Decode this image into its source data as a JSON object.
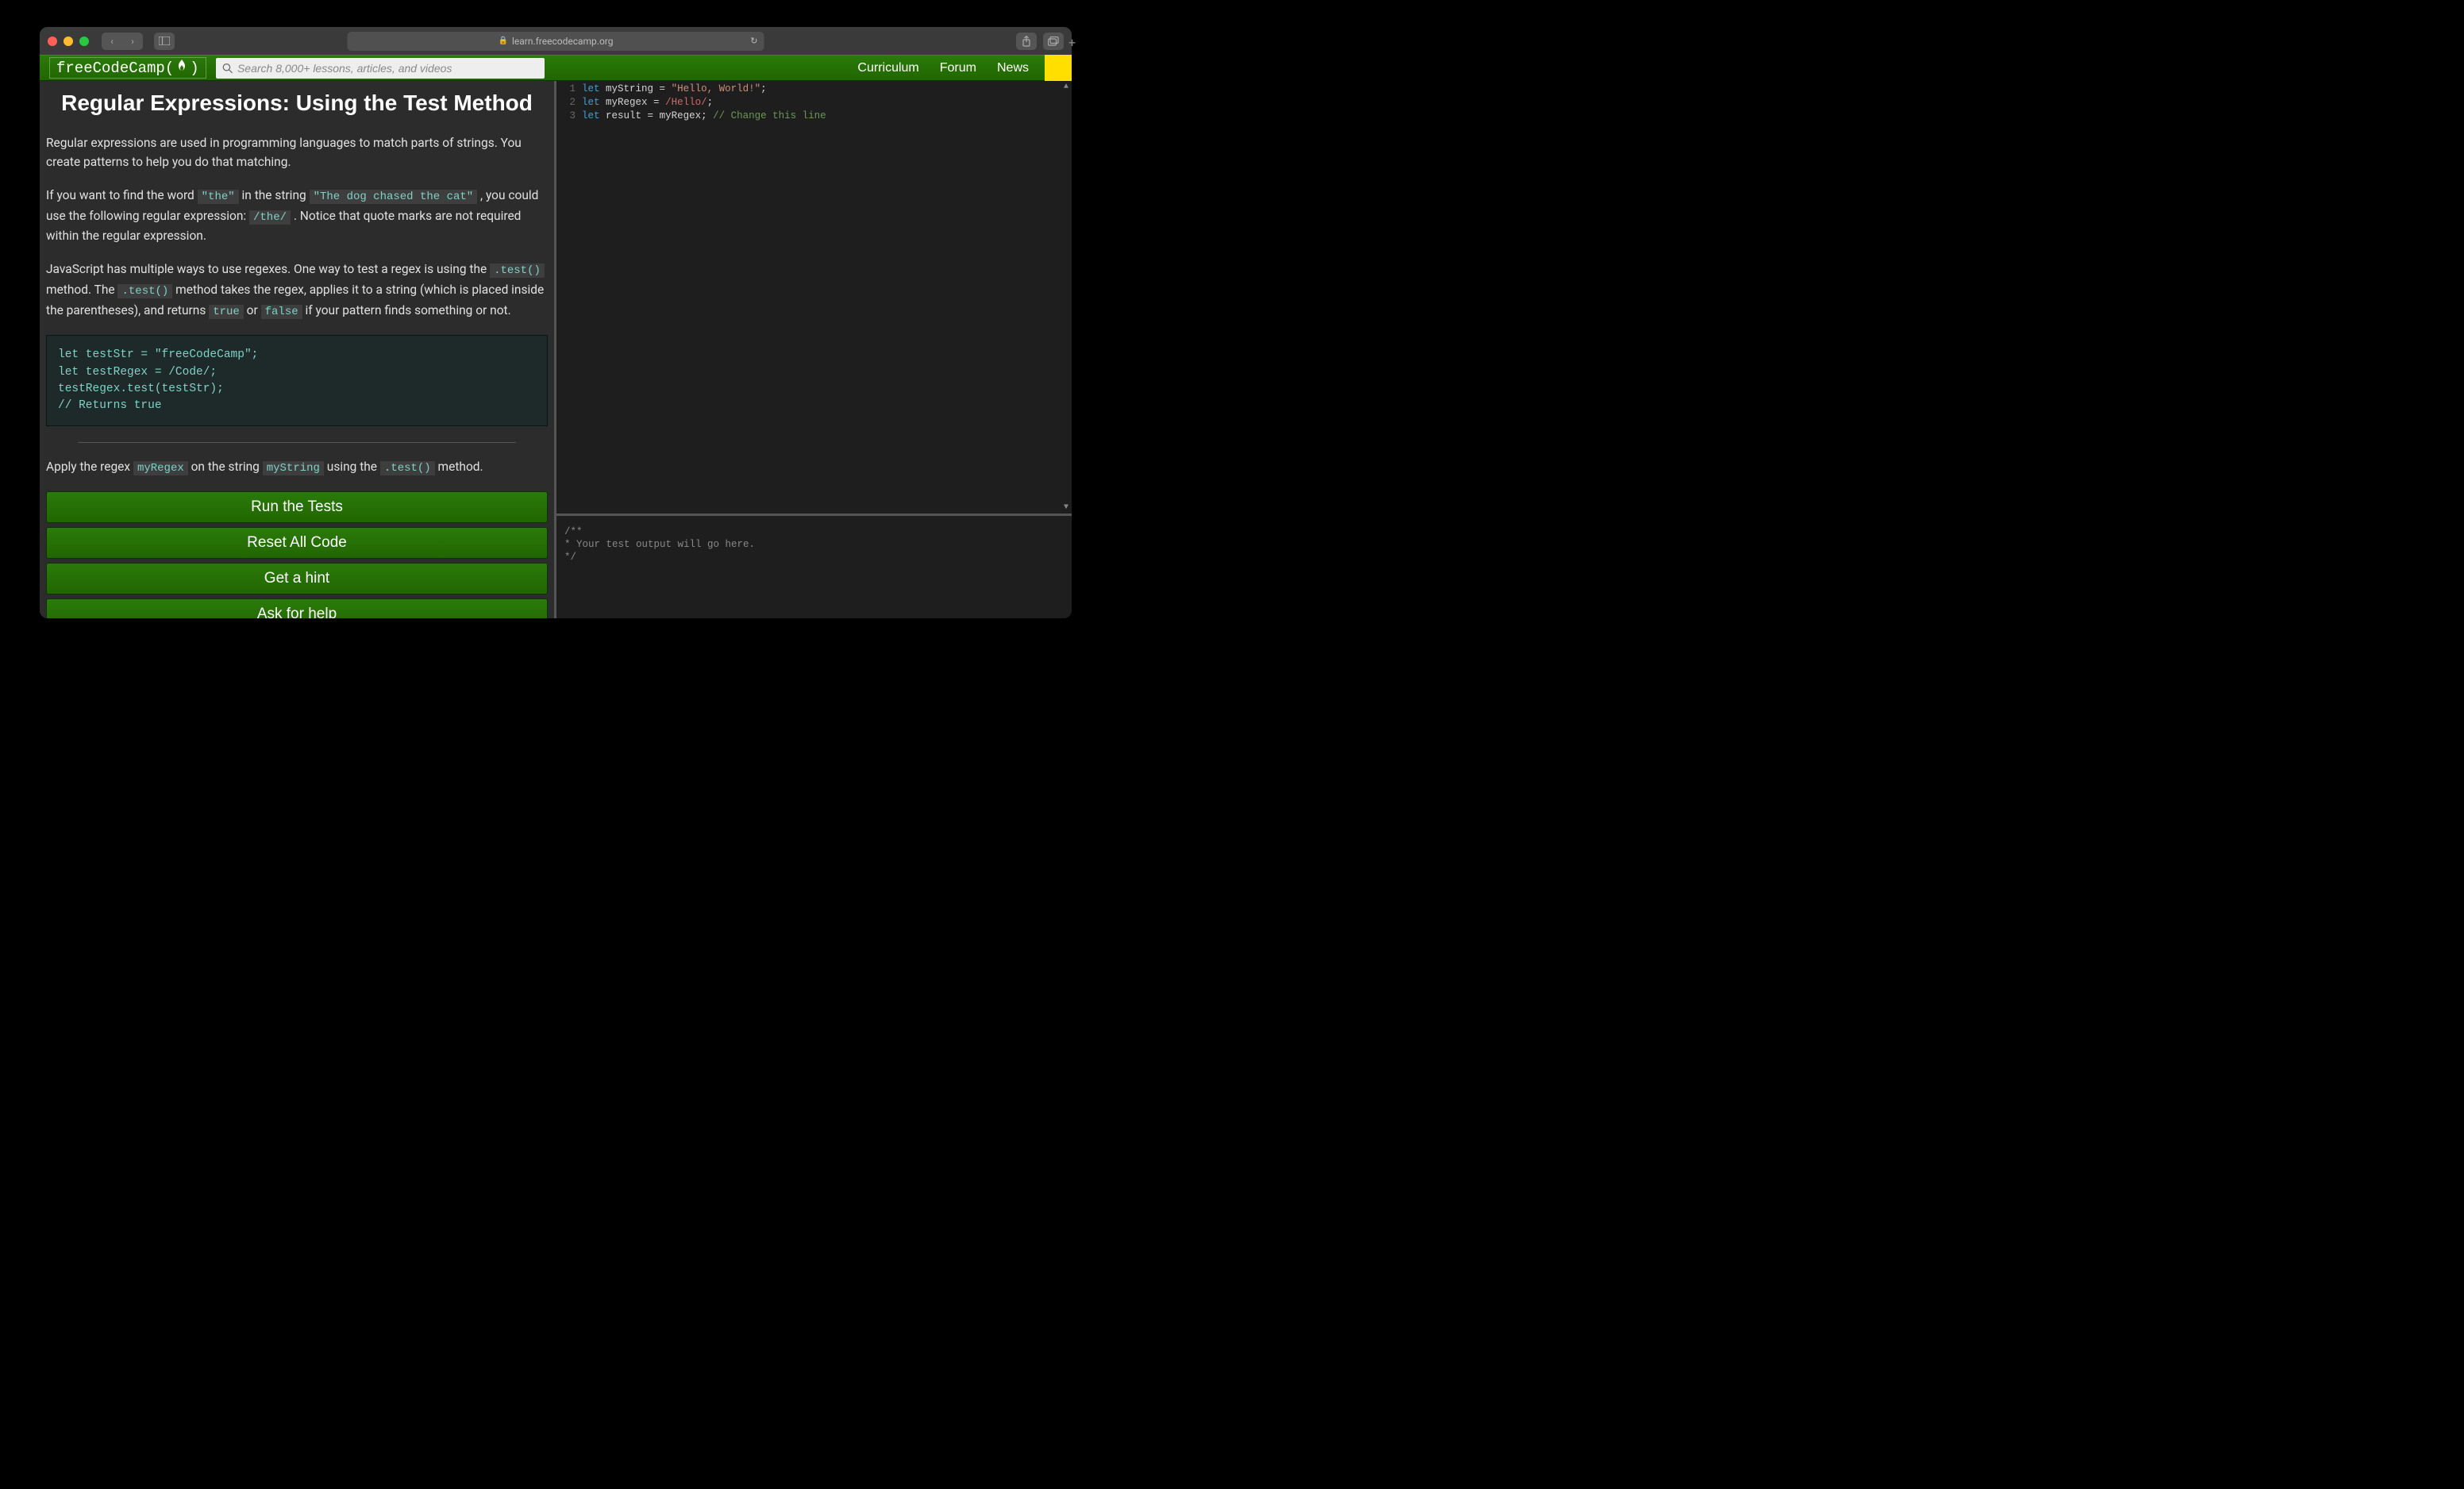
{
  "browser": {
    "url_host": "learn.freecodecamp.org"
  },
  "nav": {
    "brand": "freeCodeCamp(",
    "brand_close": ")",
    "search_placeholder": "Search 8,000+ lessons, articles, and videos",
    "links": [
      "Curriculum",
      "Forum",
      "News"
    ]
  },
  "lesson": {
    "title": "Regular Expressions: Using the Test Method",
    "p1": "Regular expressions are used in programming languages to match parts of strings. You create patterns to help you do that matching.",
    "p2a": "If you want to find the word ",
    "code_the": "\"the\"",
    "p2b": " in the string ",
    "code_sentence": "\"The dog chased the cat\"",
    "p2c": " , you could use the following regular expression: ",
    "code_theRegex": "/the/",
    "p2d": " . Notice that quote marks are not required within the regular expression.",
    "p3a": "JavaScript has multiple ways to use regexes. One way to test a regex is using the ",
    "code_test1": ".test()",
    "p3b": " method. The ",
    "code_test2": ".test()",
    "p3c": " method takes the regex, applies it to a string (which is placed inside the parentheses), and returns ",
    "code_true": "true",
    "p3d": " or ",
    "code_false": "false",
    "p3e": " if your pattern finds something or not.",
    "codeblock": "let testStr = \"freeCodeCamp\";\nlet testRegex = /Code/;\ntestRegex.test(testStr);\n// Returns true",
    "task_a": "Apply the regex ",
    "task_code1": "myRegex",
    "task_b": " on the string ",
    "task_code2": "myString",
    "task_c": " using the ",
    "task_code3": ".test()",
    "task_d": " method.",
    "buttons": {
      "run": "Run the Tests",
      "reset": "Reset All Code",
      "hint": "Get a hint",
      "help": "Ask for help"
    }
  },
  "editor": {
    "lines": [
      {
        "n": "1",
        "kw": "let",
        "id": "myString",
        "op": " = ",
        "str": "\"Hello, World!\"",
        "end": ";"
      },
      {
        "n": "2",
        "kw": "let",
        "id": "myRegex",
        "op": " = ",
        "reg": "/Hello/",
        "end": ";"
      },
      {
        "n": "3",
        "kw": "let",
        "id": "result",
        "op": " = ",
        "id2": "myRegex",
        "end": "; ",
        "cm": "// Change this line"
      }
    ]
  },
  "console": {
    "l1": "/**",
    "l2": "* Your test output will go here.",
    "l3": "*/"
  }
}
